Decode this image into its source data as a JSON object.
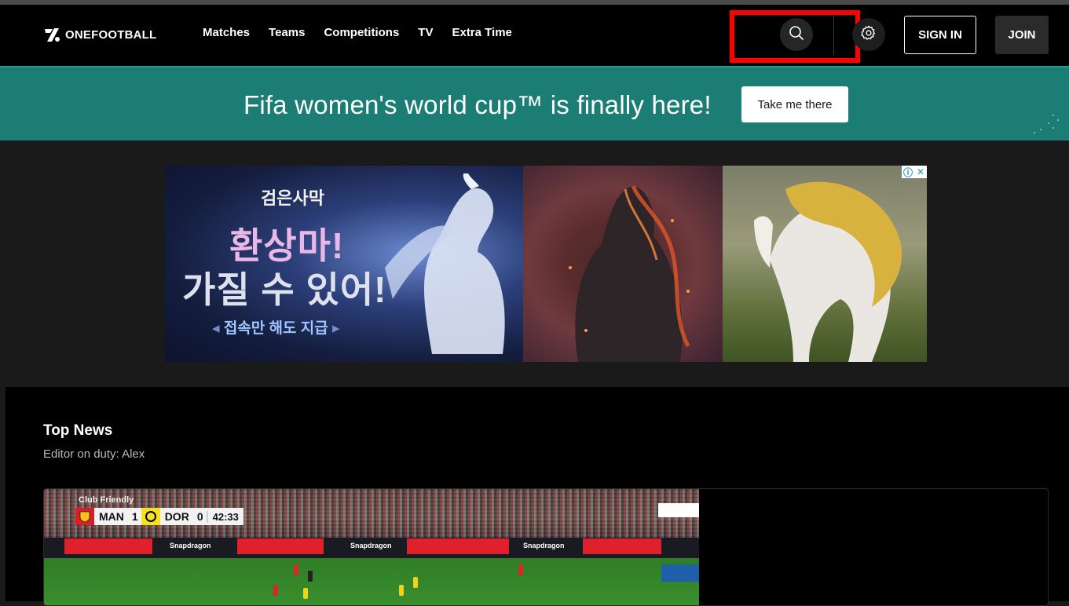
{
  "header": {
    "logo_text": "ONEFOOTBALL",
    "nav": [
      "Matches",
      "Teams",
      "Competitions",
      "TV",
      "Extra Time"
    ],
    "search_icon": "search-icon",
    "settings_icon": "gear-icon",
    "sign_in": "SIGN IN",
    "join": "JOIN",
    "highlight_color": "#ff0000"
  },
  "banner": {
    "text": "Fifa women's world cup™ is finally here!",
    "button": "Take me there",
    "color": "#1b7d74"
  },
  "ad": {
    "title_small": "검은사막",
    "title_line1": "환상마!",
    "title_line2": "가질 수 있어!",
    "cta": "접속만 해도 지급",
    "info_icon": "ⓘ",
    "close_icon": "✕"
  },
  "main": {
    "section_title": "Top News",
    "editor": "Editor on duty: Alex"
  },
  "news": {
    "label": "Club Friendly",
    "home": "MAN",
    "home_score": "1",
    "away": "DOR",
    "away_score": "0",
    "time": "42:33",
    "sponsor": "Snapdragon"
  }
}
